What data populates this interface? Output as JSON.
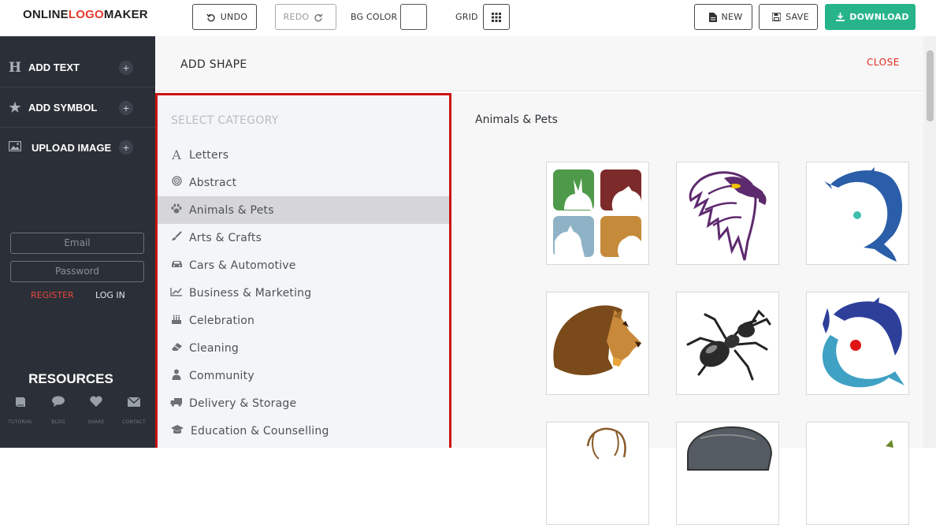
{
  "logo": {
    "part1": "ONLINE",
    "part2": "LOGO",
    "part3": "MAKER"
  },
  "toolbar": {
    "undo": "UNDO",
    "redo": "REDO",
    "bg_color": "BG COLOR",
    "grid": "GRID",
    "new": "NEW",
    "save": "SAVE",
    "download": "DOWNLOAD"
  },
  "sidebar": {
    "items": [
      {
        "label": "ADD TEXT",
        "icon": "H"
      },
      {
        "label": "ADD SYMBOL",
        "icon": "★"
      },
      {
        "label": "UPLOAD IMAGE",
        "icon": "▣"
      }
    ],
    "plus": "+",
    "email_placeholder": "Email",
    "password_placeholder": "Password",
    "register": "REGISTER",
    "login": "LOG IN",
    "resources_title": "RESOURCES",
    "resources": [
      {
        "label": "TUTORIAL",
        "icon": "book-icon"
      },
      {
        "label": "BLOG",
        "icon": "comment-icon"
      },
      {
        "label": "SHARE",
        "icon": "heart-icon"
      },
      {
        "label": "CONTACT",
        "icon": "envelope-icon"
      }
    ]
  },
  "panel": {
    "title": "ADD SHAPE",
    "close": "CLOSE"
  },
  "categories": {
    "heading": "SELECT CATEGORY",
    "items": [
      {
        "label": "Letters",
        "icon": "letter-a-icon"
      },
      {
        "label": "Abstract",
        "icon": "target-icon"
      },
      {
        "label": "Animals & Pets",
        "icon": "paw-icon",
        "active": true
      },
      {
        "label": "Arts & Crafts",
        "icon": "paintbrush-icon"
      },
      {
        "label": "Cars & Automotive",
        "icon": "car-icon"
      },
      {
        "label": "Business & Marketing",
        "icon": "line-chart-icon"
      },
      {
        "label": "Celebration",
        "icon": "cake-icon"
      },
      {
        "label": "Cleaning",
        "icon": "eraser-icon"
      },
      {
        "label": "Community",
        "icon": "person-icon"
      },
      {
        "label": "Delivery & Storage",
        "icon": "truck-icon"
      },
      {
        "label": "Education & Counselling",
        "icon": "graduation-cap-icon"
      }
    ]
  },
  "gallery": {
    "title": "Animals & Pets"
  },
  "colors": {
    "accent_red": "#cc1212",
    "download_green": "#27b48a",
    "sidebar_bg": "#2b3038"
  }
}
